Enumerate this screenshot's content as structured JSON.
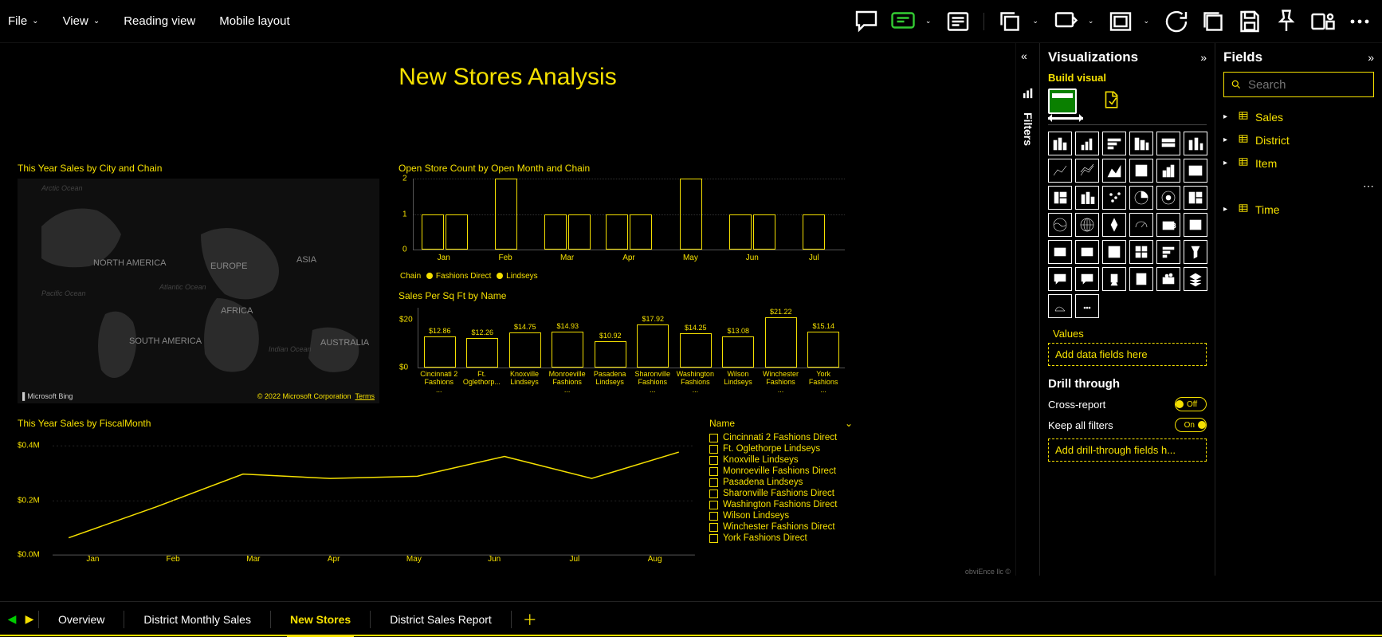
{
  "toolbar": {
    "menu": [
      "File",
      "View",
      "Reading view",
      "Mobile layout"
    ]
  },
  "report": {
    "title": "New Stores Analysis",
    "map_title": "This Year Sales by City and Chain",
    "map_labels": {
      "na": "NORTH AMERICA",
      "sa": "SOUTH AMERICA",
      "eu": "EUROPE",
      "af": "AFRICA",
      "as": "ASIA",
      "au": "AUSTRALIA"
    },
    "map_oceans": {
      "arctic": "Arctic Ocean",
      "pacific": "Pacific Ocean",
      "atlantic": "Atlantic Ocean",
      "indian": "Indian Ocean"
    },
    "map_credit_left": "Microsoft Bing",
    "map_credit_right": "© 2022 Microsoft Corporation",
    "map_terms": "Terms",
    "bc1_title": "Open Store Count by Open Month and Chain",
    "bc1_legend_label": "Chain",
    "bc1_legend": [
      "Fashions Direct",
      "Lindseys"
    ],
    "bc2_title": "Sales Per Sq Ft by Name",
    "lc_title": "This Year Sales by FiscalMonth",
    "legend_header": "Name",
    "legend_items": [
      "Cincinnati 2 Fashions Direct",
      "Ft. Oglethorpe Lindseys",
      "Knoxville Lindseys",
      "Monroeville Fashions Direct",
      "Pasadena Lindseys",
      "Sharonville Fashions Direct",
      "Washington Fashions Direct",
      "Wilson Lindseys",
      "Winchester Fashions Direct",
      "York Fashions Direct"
    ],
    "watermark": "obviEnce llc ©"
  },
  "viz_panel": {
    "title": "Visualizations",
    "build": "Build visual",
    "values_label": "Values",
    "values_placeholder": "Add data fields here",
    "drill_header": "Drill through",
    "cross_report": "Cross-report",
    "cross_report_state": "Off",
    "keep_filters": "Keep all filters",
    "keep_filters_state": "On",
    "drill_placeholder": "Add drill-through fields h..."
  },
  "filters_label": "Filters",
  "fields_panel": {
    "title": "Fields",
    "search_placeholder": "Search",
    "items": [
      "Sales",
      "District",
      "Item",
      "",
      "Time"
    ]
  },
  "tabs": {
    "pages": [
      "Overview",
      "District Monthly Sales",
      "New Stores",
      "District Sales Report"
    ],
    "active_index": 2
  },
  "chart_data": {
    "open_store_count": {
      "type": "bar",
      "title": "Open Store Count by Open Month and Chain",
      "xlabel": "",
      "ylabel": "",
      "ylim": [
        0,
        2
      ],
      "categories": [
        "Jan",
        "Feb",
        "Mar",
        "Apr",
        "May",
        "Jun",
        "Jul"
      ],
      "series": [
        {
          "name": "Fashions Direct",
          "values": [
            1,
            2,
            1,
            1,
            2,
            1,
            1
          ]
        },
        {
          "name": "Lindseys",
          "values": [
            1,
            null,
            1,
            1,
            null,
            1,
            null
          ]
        }
      ]
    },
    "sales_per_sqft": {
      "type": "bar",
      "title": "Sales Per Sq Ft by Name",
      "ylim": [
        0,
        25
      ],
      "categories": [
        "Cincinnati 2 Fashions ...",
        "Ft. Oglethorp...",
        "Knoxville Lindseys",
        "Monroeville Fashions ...",
        "Pasadena Lindseys",
        "Sharonville Fashions ...",
        "Washington Fashions ...",
        "Wilson Lindseys",
        "Winchester Fashions ...",
        "York Fashions ..."
      ],
      "values": [
        12.86,
        12.26,
        14.75,
        14.93,
        10.92,
        17.92,
        14.25,
        13.08,
        21.22,
        15.14
      ],
      "labels": [
        "$12.86",
        "$12.26",
        "$14.75",
        "$14.93",
        "$10.92",
        "$17.92",
        "$14.25",
        "$13.08",
        "$21.22",
        "$15.14"
      ]
    },
    "this_year_sales": {
      "type": "line",
      "title": "This Year Sales by FiscalMonth",
      "ylim": [
        0,
        0.5
      ],
      "yunit": "M$",
      "yticks": [
        "$0.0M",
        "$0.2M",
        "$0.4M"
      ],
      "categories": [
        "Jan",
        "Feb",
        "Mar",
        "Apr",
        "May",
        "Jun",
        "Jul",
        "Aug"
      ],
      "values": [
        0.06,
        0.2,
        0.35,
        0.33,
        0.34,
        0.43,
        0.33,
        0.45
      ]
    }
  }
}
